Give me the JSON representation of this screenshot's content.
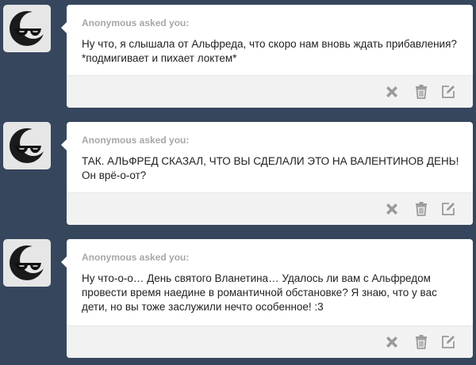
{
  "posts": [
    {
      "asker": "Anonymous asked you:",
      "question": "Ну что, я слышала от Альфреда, что скоро нам вновь ждать прибавления? *подмигивает и пихает локтем*",
      "avatar_icon": "sunglasses-moon-avatar-icon"
    },
    {
      "asker": "Anonymous asked you:",
      "question": "ТАК. АЛЬФРЕД СКАЗАЛ, ЧТО ВЫ СДЕЛАЛИ ЭТО НА ВАЛЕНТИНОВ ДЕНЬ! Он врё-о-от?",
      "avatar_icon": "sunglasses-moon-avatar-icon"
    },
    {
      "asker": "Anonymous asked you:",
      "question": "Ну что-о-о… День святого Вланетина… Удалось ли вам с Альфредом провести время наедине в романтичной обстановке? Я знаю, что у вас дети, но вы тоже заслужили нечто особенное! :3",
      "avatar_icon": "sunglasses-moon-avatar-icon"
    }
  ],
  "actions": {
    "delete_icon": "close-icon",
    "trash_icon": "trash-icon",
    "edit_icon": "edit-icon"
  },
  "colors": {
    "background": "#36465d",
    "card": "#ffffff",
    "footer": "#f2f2f2",
    "asker_text": "#a7a7a7",
    "icon": "#9a9a9a"
  }
}
